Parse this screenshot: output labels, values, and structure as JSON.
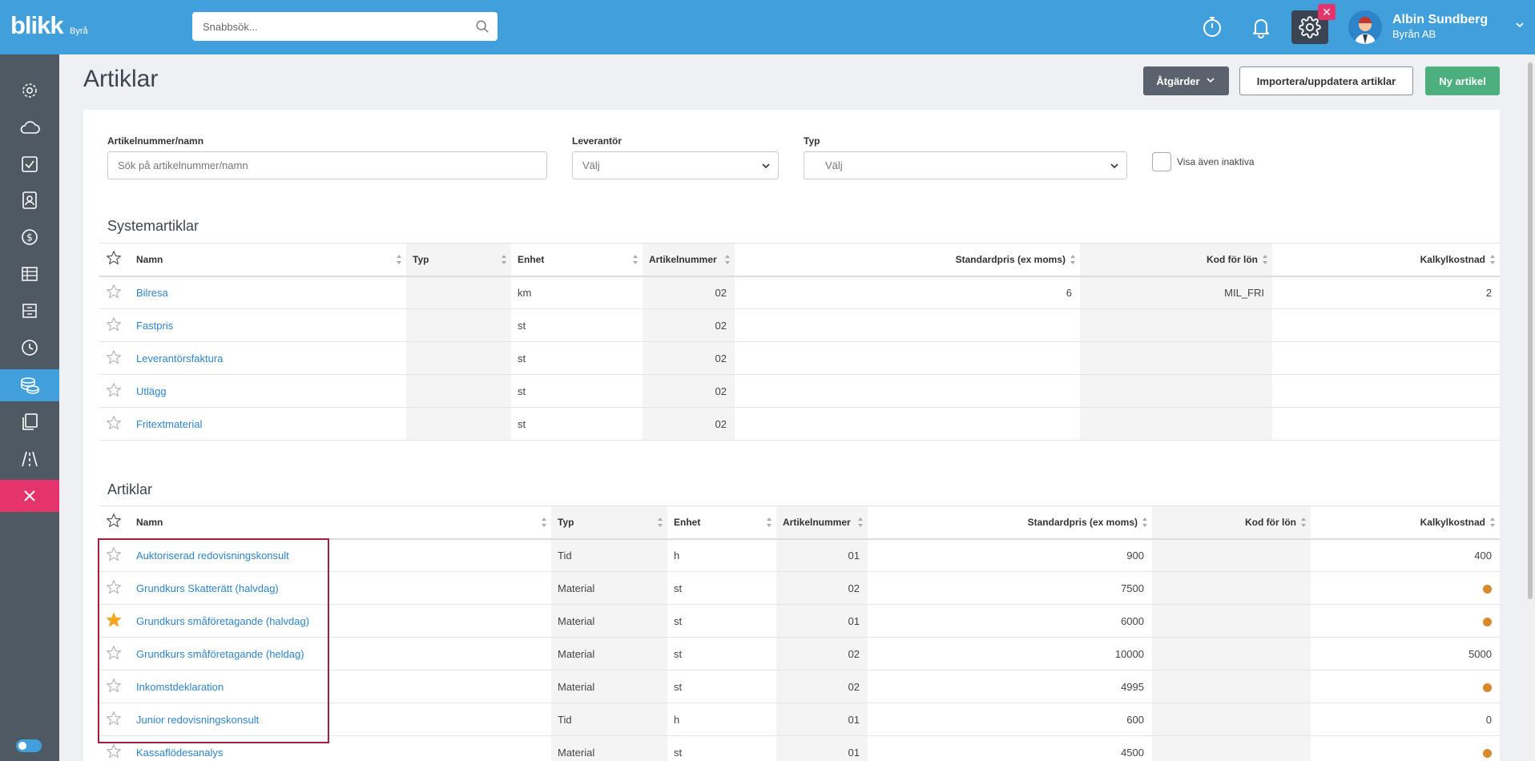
{
  "app": {
    "logo": "blikk",
    "logo_sub": "Byrå"
  },
  "search": {
    "placeholder": "Snabbsök..."
  },
  "topbar": {
    "badge": "✕"
  },
  "user": {
    "name": "Albin Sundberg",
    "company": "Byrån AB"
  },
  "page": {
    "title": "Artiklar",
    "actions_label": "Åtgärder",
    "import_label": "Importera/uppdatera artiklar",
    "new_label": "Ny artikel"
  },
  "filters": {
    "article_label": "Artikelnummer/namn",
    "article_placeholder": "Sök på artikelnummer/namn",
    "supplier_label": "Leverantör",
    "supplier_value": "Välj",
    "type_label": "Typ",
    "type_value": "Välj",
    "inactive_label": "Visa även inaktiva"
  },
  "system": {
    "title": "Systemartiklar",
    "columns": [
      "Namn",
      "Typ",
      "Enhet",
      "Artikelnummer",
      "Standardpris (ex moms)",
      "Kod för lön",
      "Kalkylkostnad"
    ],
    "rows": [
      {
        "name": "Bilresa",
        "type": "",
        "unit": "km",
        "number": "02",
        "price": "6",
        "salary_code": "MIL_FRI",
        "cost": "2"
      },
      {
        "name": "Fastpris",
        "type": "",
        "unit": "st",
        "number": "02",
        "price": "",
        "salary_code": "",
        "cost": ""
      },
      {
        "name": "Leverantörsfaktura",
        "type": "",
        "unit": "st",
        "number": "02",
        "price": "",
        "salary_code": "",
        "cost": ""
      },
      {
        "name": "Utlägg",
        "type": "",
        "unit": "st",
        "number": "02",
        "price": "",
        "salary_code": "",
        "cost": ""
      },
      {
        "name": "Fritextmaterial",
        "type": "",
        "unit": "st",
        "number": "02",
        "price": "",
        "salary_code": "",
        "cost": ""
      }
    ]
  },
  "articles": {
    "title": "Artiklar",
    "columns": [
      "Namn",
      "Typ",
      "Enhet",
      "Artikelnummer",
      "Standardpris (ex moms)",
      "Kod för lön",
      "Kalkylkostnad"
    ],
    "rows": [
      {
        "name": "Auktoriserad redovisningskonsult",
        "type": "Tid",
        "unit": "h",
        "number": "01",
        "price": "900",
        "salary_code": "",
        "cost": "400",
        "starred": false
      },
      {
        "name": "Grundkurs Skatterätt (halvdag)",
        "type": "Material",
        "unit": "st",
        "number": "02",
        "price": "7500",
        "salary_code": "",
        "cost": "",
        "starred": false
      },
      {
        "name": "Grundkurs småföretagande (halvdag)",
        "type": "Material",
        "unit": "st",
        "number": "01",
        "price": "6000",
        "salary_code": "",
        "cost": "",
        "starred": true
      },
      {
        "name": "Grundkurs småföretagande (heldag)",
        "type": "Material",
        "unit": "st",
        "number": "02",
        "price": "10000",
        "salary_code": "",
        "cost": "5000",
        "starred": false
      },
      {
        "name": "Inkomstdeklaration",
        "type": "Material",
        "unit": "st",
        "number": "02",
        "price": "4995",
        "salary_code": "",
        "cost": "",
        "starred": false
      },
      {
        "name": "Junior redovisningskonsult",
        "type": "Tid",
        "unit": "h",
        "number": "01",
        "price": "600",
        "salary_code": "",
        "cost": "0",
        "starred": false
      },
      {
        "name": "Kassaflödesanalys",
        "type": "Material",
        "unit": "st",
        "number": "01",
        "price": "4500",
        "salary_code": "",
        "cost": "",
        "starred": false
      }
    ]
  },
  "colors": {
    "brand": "#41a0db",
    "sidebar": "#4f5964",
    "accent_pink": "#e5346c",
    "green": "#4caf7d",
    "link": "#2e84c9",
    "star_active": "#f5a623",
    "dot": "#d8892e"
  },
  "icons": [
    "search-icon",
    "stopwatch-icon",
    "bell-icon",
    "gear-icon",
    "chevron-down-icon",
    "star-icon",
    "sort-icon"
  ]
}
